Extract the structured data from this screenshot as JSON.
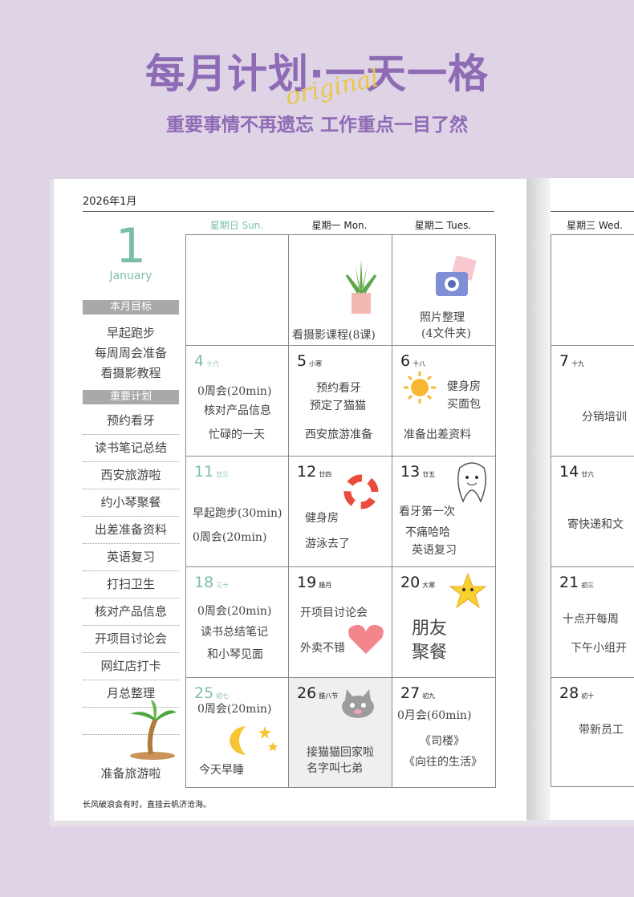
{
  "banner": {
    "title": "每月计划·一天一格",
    "script": "original",
    "subtitle": "重要事情不再遗忘 工作重点一目了然"
  },
  "sidebar": {
    "year_month": "2026年1月",
    "big_number": "1",
    "month_name": "January",
    "goals_header": "本月目标",
    "goals": [
      "早起跑步",
      "每周周会准备",
      "看摄影教程"
    ],
    "plans_header": "重要计划",
    "plans": [
      "预约看牙",
      "读书笔记总结",
      "西安旅游啦",
      "约小琴聚餐",
      "出差准备资料",
      "英语复习",
      "打扫卫生",
      "核对产品信息",
      "开项目讨论会",
      "网红店打卡",
      "月总整理",
      "",
      "准备旅游啦"
    ]
  },
  "weekdays": [
    "星期日 Sun.",
    "星期一 Mon.",
    "星期二 Tues.",
    "星期三 Wed."
  ],
  "weeks": [
    [
      {
        "day": "",
        "lunar": "",
        "notes": []
      },
      {
        "day": "",
        "lunar": "",
        "notes": [
          "看摄影课程(8课)"
        ]
      },
      {
        "day": "",
        "lunar": "",
        "notes": [
          "照片整理",
          "(4文件夹)"
        ]
      },
      {
        "day": "",
        "lunar": "",
        "notes": []
      }
    ],
    [
      {
        "day": "4",
        "lunar": "十六",
        "notes": [
          "0周会(20min)",
          "核对产品信息",
          "忙碌的一天"
        ]
      },
      {
        "day": "5",
        "lunar": "小寒",
        "notes": [
          "预约看牙",
          "预定了猫猫",
          "西安旅游准备"
        ]
      },
      {
        "day": "6",
        "lunar": "十八",
        "notes": [
          "健身房",
          "买面包",
          "准备出差资料"
        ]
      },
      {
        "day": "7",
        "lunar": "十九",
        "notes": [
          "分销培训"
        ]
      }
    ],
    [
      {
        "day": "11",
        "lunar": "廿三",
        "notes": [
          "早起跑步(30min)",
          "0周会(20min)"
        ]
      },
      {
        "day": "12",
        "lunar": "廿四",
        "notes": [
          "健身房",
          "游泳去了"
        ]
      },
      {
        "day": "13",
        "lunar": "廿五",
        "notes": [
          "看牙第一次",
          "不痛哈哈",
          "英语复习"
        ]
      },
      {
        "day": "14",
        "lunar": "廿六",
        "notes": [
          "寄快递和文"
        ]
      }
    ],
    [
      {
        "day": "18",
        "lunar": "三十",
        "notes": [
          "0周会(20min)",
          "读书总结笔记",
          "和小琴见面"
        ]
      },
      {
        "day": "19",
        "lunar": "腊月",
        "notes": [
          "开项目讨论会",
          "外卖不错"
        ]
      },
      {
        "day": "20",
        "lunar": "大寒",
        "notes": [
          "朋友",
          "聚餐"
        ]
      },
      {
        "day": "21",
        "lunar": "初三",
        "notes": [
          "十点开每周",
          "下午小组开"
        ]
      }
    ],
    [
      {
        "day": "25",
        "lunar": "初七",
        "notes": [
          "0周会(20min)",
          "今天早睡"
        ]
      },
      {
        "day": "26",
        "lunar": "腊八节",
        "notes": [
          "接猫猫回家啦",
          "名字叫七弟"
        ]
      },
      {
        "day": "27",
        "lunar": "初九",
        "notes": [
          "0月会(60min)",
          "《司楼》",
          "《向往的生活》"
        ]
      },
      {
        "day": "28",
        "lunar": "初十",
        "notes": [
          "带新员工"
        ]
      }
    ]
  ],
  "footer": "长风破浪会有时，直挂云帆济沧海。",
  "colors": {
    "background": "#dfd3e6",
    "title": "#8d6bb5",
    "sunday": "#7dbfa5",
    "script": "#e8c84a"
  },
  "icons": [
    "aloe-plant-icon",
    "camera-icon",
    "sun-icon",
    "lifebuoy-icon",
    "tooth-icon",
    "star-icon",
    "heart-icon",
    "moon-icon",
    "cat-icon",
    "palm-tree-icon"
  ]
}
